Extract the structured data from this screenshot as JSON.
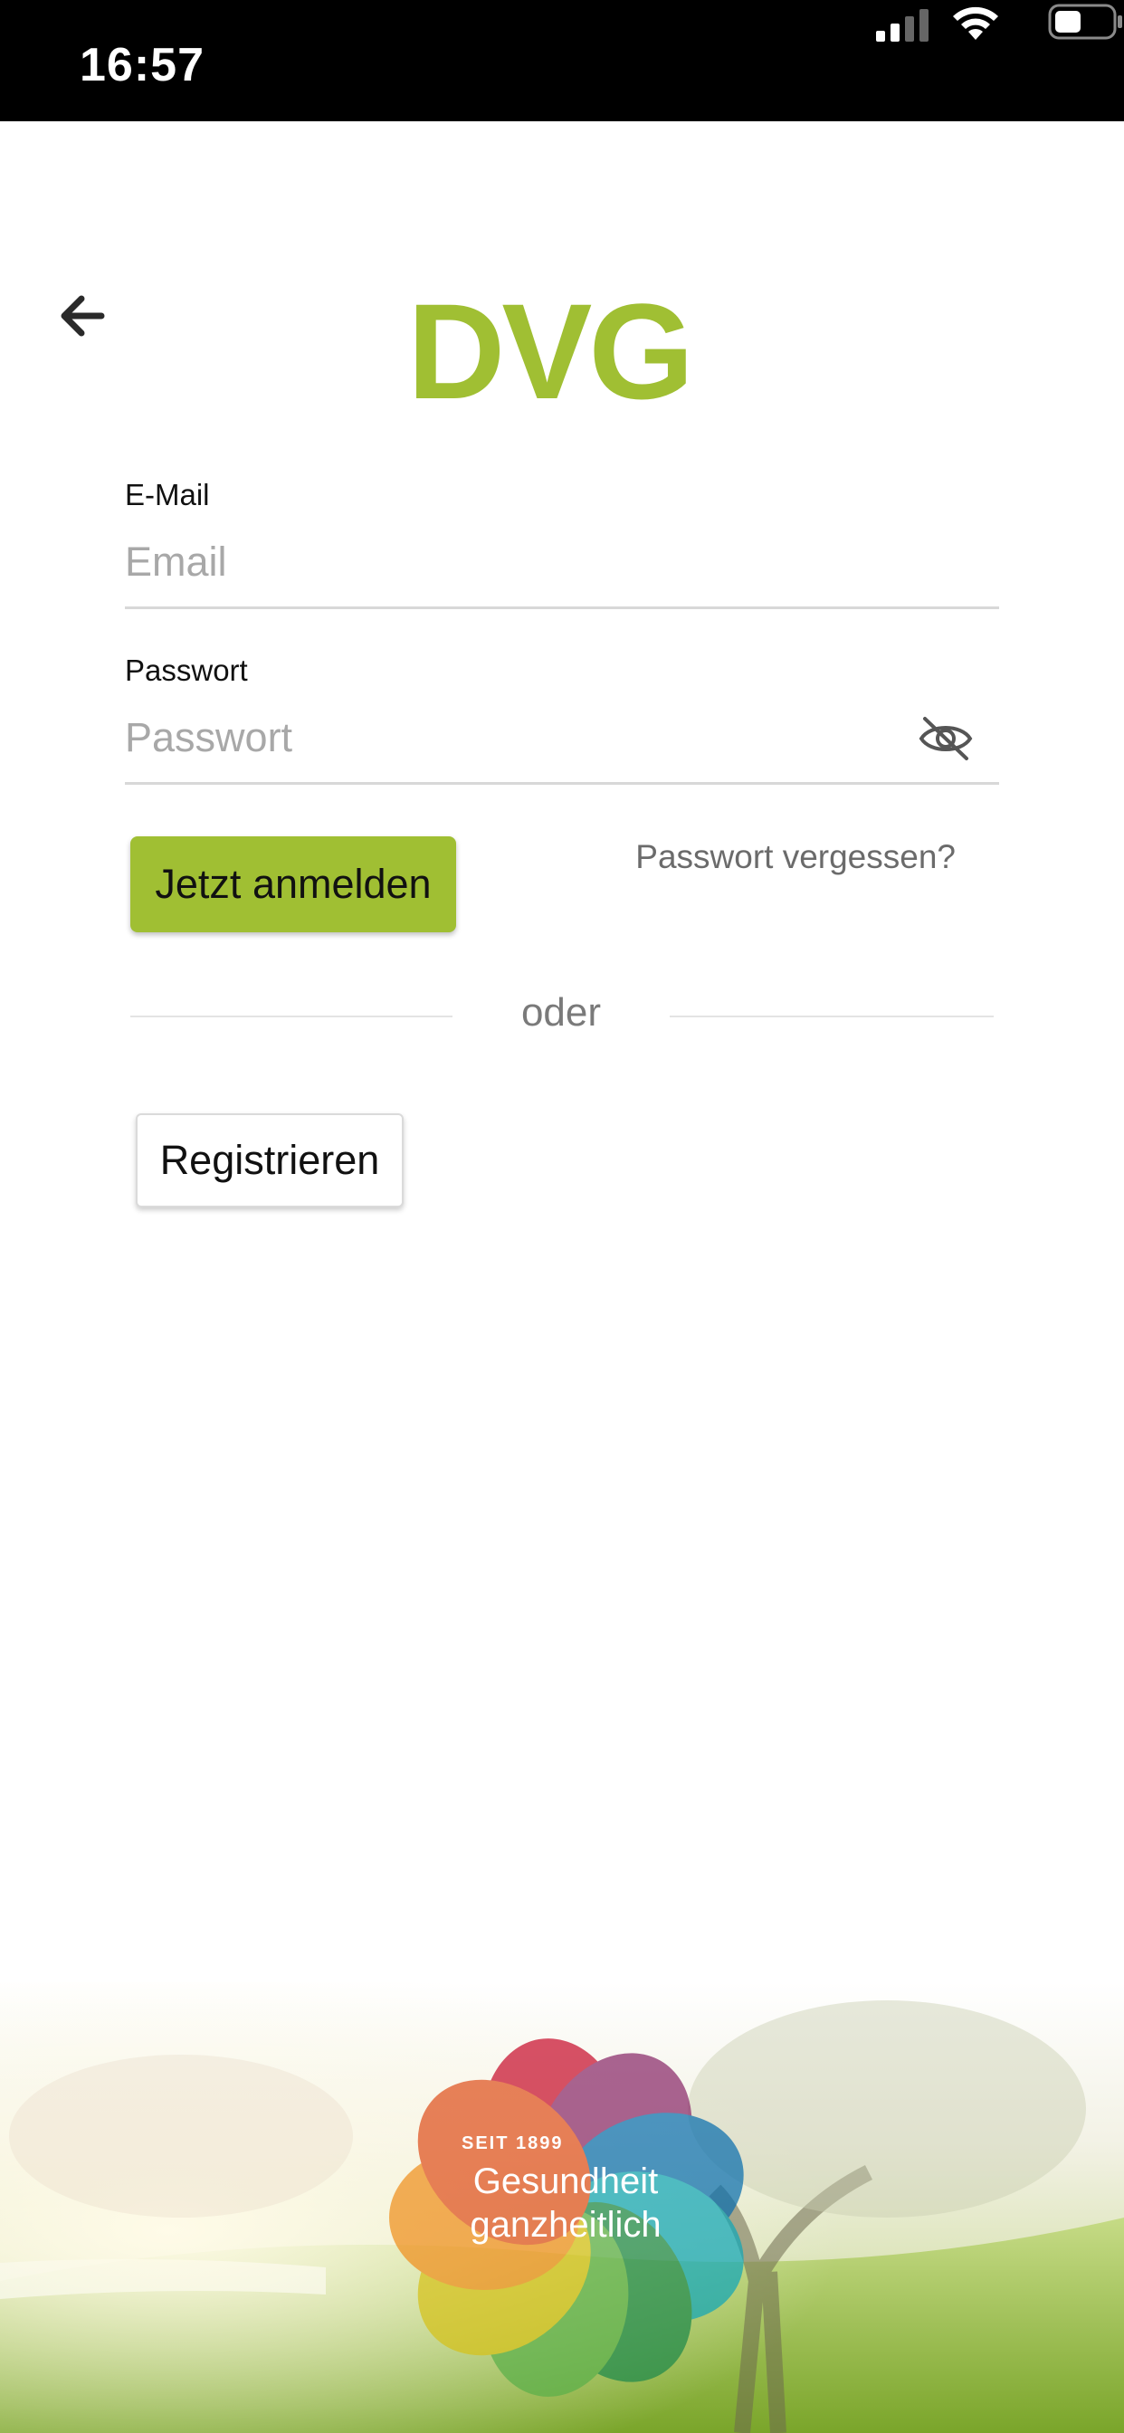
{
  "status_bar": {
    "time": "16:57"
  },
  "logo": {
    "text": "DVG"
  },
  "login_form": {
    "email": {
      "label": "E-Mail",
      "placeholder": "Email"
    },
    "password": {
      "label": "Passwort",
      "placeholder": "Passwort"
    },
    "login_button": "Jetzt anmelden",
    "forgot_link": "Passwort vergessen?",
    "divider_text": "oder",
    "register_button": "Registrieren"
  },
  "footer_badge": {
    "kicker": "SEIT 1899",
    "line1": "Gesundheit",
    "line2": "ganzheitlich"
  },
  "colors": {
    "brand_green": "#a0bf33",
    "status_bar": "#000000"
  }
}
